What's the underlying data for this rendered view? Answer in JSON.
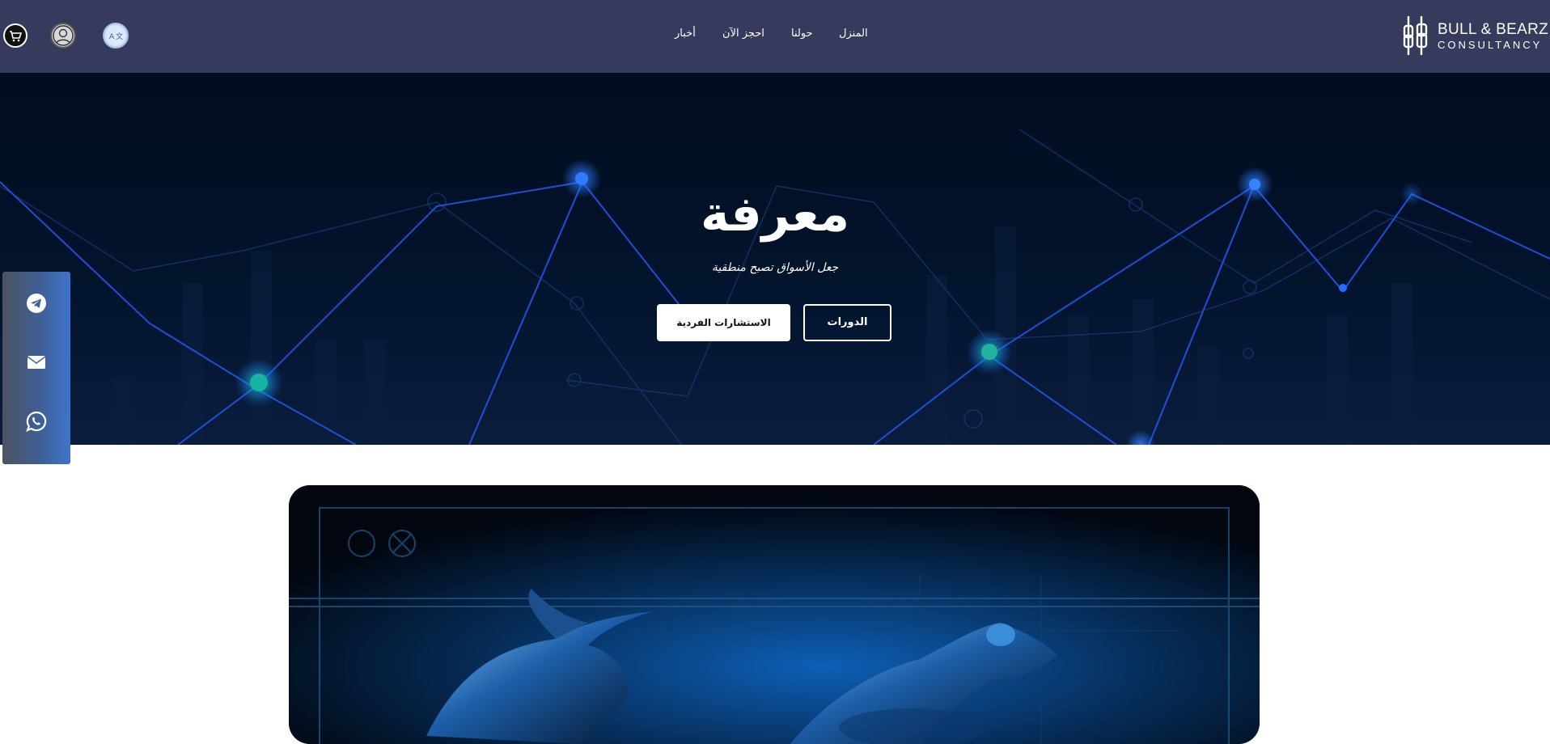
{
  "header": {
    "brand": {
      "line1": "BULL & BEARZ",
      "line2": "CONSULTANCY"
    },
    "nav": {
      "home": "المنزل",
      "about": "حولنا",
      "book_now": "احجز الآن",
      "news": "أخبار"
    },
    "icons": [
      "cart-icon",
      "user-icon",
      "language-icon"
    ]
  },
  "hero": {
    "title": "معرفة",
    "subtitle": "جعل الأسواق تصبح منطقية",
    "buttons": {
      "courses": "الدورات",
      "consultations": "الاستشارات الفردية"
    }
  },
  "social": {
    "items": [
      "telegram-icon",
      "email-icon",
      "whatsapp-icon"
    ]
  },
  "colors": {
    "header_bg": "#363a5c",
    "hero_bg": "#020d1f",
    "accent_blue": "#1f5bff",
    "social_panel": "#3f74c9"
  }
}
